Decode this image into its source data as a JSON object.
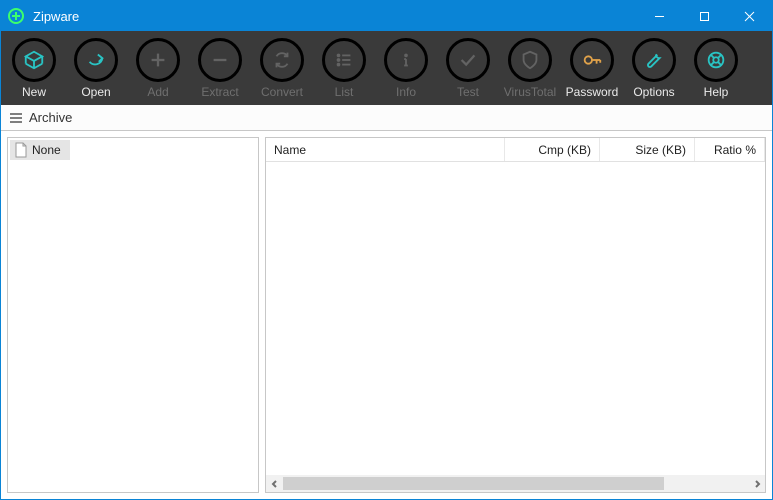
{
  "window": {
    "title": "Zipware"
  },
  "toolbar": [
    {
      "id": "new",
      "label": "New",
      "icon": "cube",
      "color": "cyan",
      "text": "white",
      "enabled": true
    },
    {
      "id": "open",
      "label": "Open",
      "icon": "arrow",
      "color": "cyan",
      "text": "white",
      "enabled": true
    },
    {
      "id": "add",
      "label": "Add",
      "icon": "plus",
      "color": "grey",
      "text": "grey",
      "enabled": false
    },
    {
      "id": "extract",
      "label": "Extract",
      "icon": "minus",
      "color": "grey",
      "text": "grey",
      "enabled": false
    },
    {
      "id": "convert",
      "label": "Convert",
      "icon": "swap",
      "color": "grey",
      "text": "grey",
      "enabled": false
    },
    {
      "id": "list",
      "label": "List",
      "icon": "list",
      "color": "grey",
      "text": "grey",
      "enabled": false
    },
    {
      "id": "info",
      "label": "Info",
      "icon": "info",
      "color": "grey",
      "text": "grey",
      "enabled": false
    },
    {
      "id": "test",
      "label": "Test",
      "icon": "check",
      "color": "grey",
      "text": "grey",
      "enabled": false
    },
    {
      "id": "virustotal",
      "label": "VirusTotal",
      "icon": "shield",
      "color": "grey",
      "text": "grey",
      "enabled": false
    },
    {
      "id": "password",
      "label": "Password",
      "icon": "key",
      "color": "orange",
      "text": "white",
      "enabled": true
    },
    {
      "id": "options",
      "label": "Options",
      "icon": "wrench",
      "color": "cyan",
      "text": "white",
      "enabled": true
    },
    {
      "id": "help",
      "label": "Help",
      "icon": "ring",
      "color": "cyan",
      "text": "white",
      "enabled": true
    }
  ],
  "breadcrumb": {
    "label": "Archive"
  },
  "tree": {
    "root_label": "None"
  },
  "columns": {
    "name": "Name",
    "cmp": "Cmp (KB)",
    "size": "Size (KB)",
    "ratio": "Ratio %"
  },
  "rows": []
}
